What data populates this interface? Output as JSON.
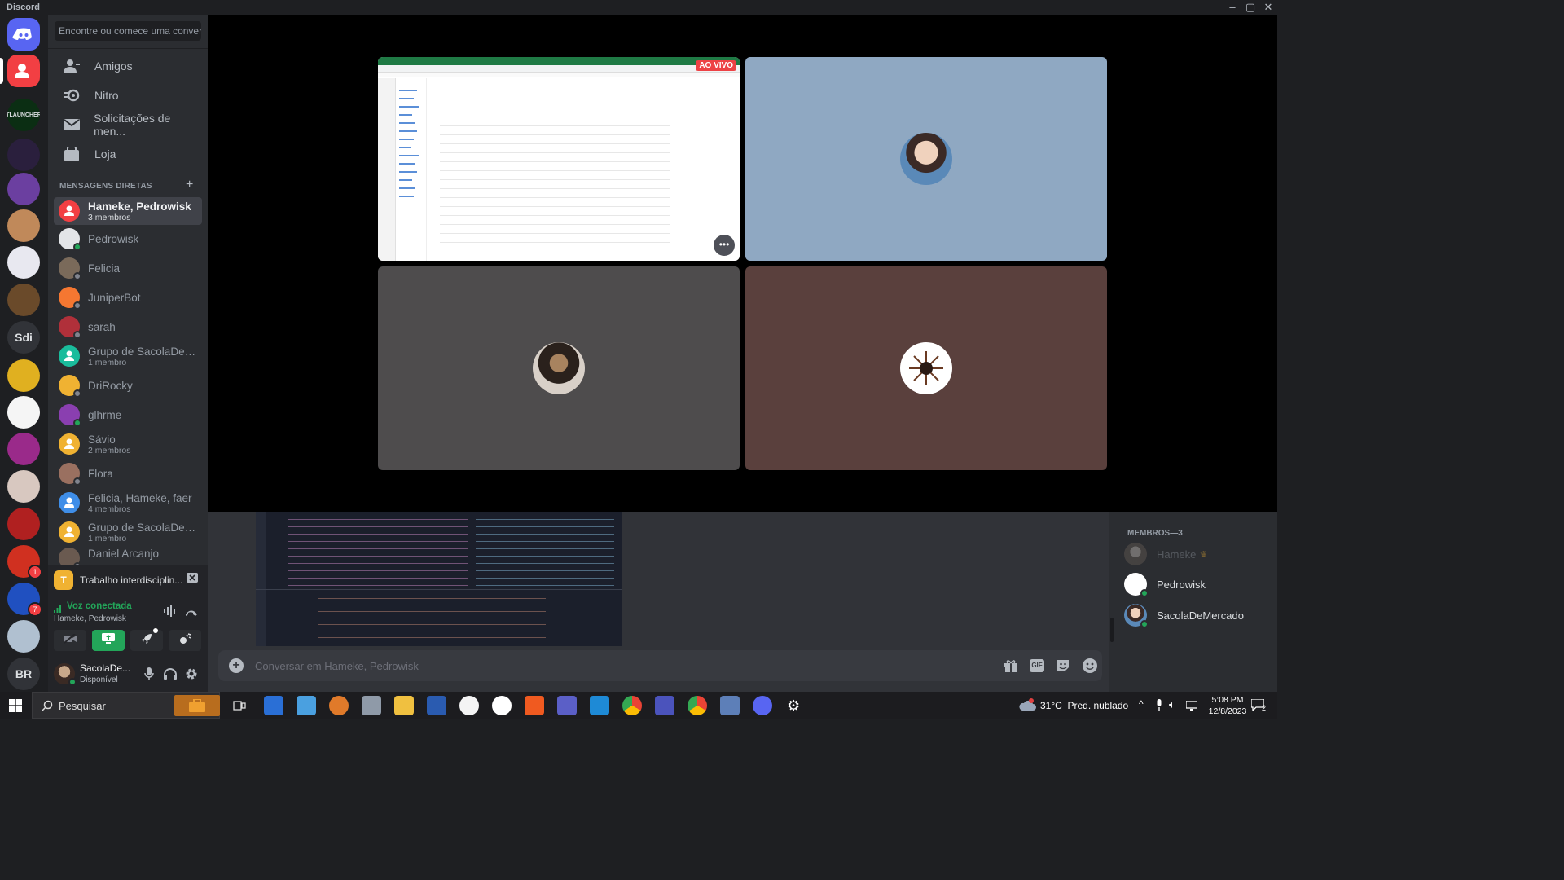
{
  "window": {
    "title": "Discord"
  },
  "sidebar": {
    "search_placeholder": "Encontre ou comece uma conver...",
    "nav": [
      {
        "label": "Amigos",
        "icon": "friends-icon"
      },
      {
        "label": "Nitro",
        "icon": "nitro-icon"
      },
      {
        "label": "Solicitações de men...",
        "icon": "message-requests-icon"
      },
      {
        "label": "Loja",
        "icon": "shop-icon"
      }
    ],
    "dm_header": "MENSAGENS DIRETAS",
    "dms": [
      {
        "name": "Hameke, Pedrowisk",
        "sub": "3 membros",
        "color": "#f23f43"
      },
      {
        "name": "Pedrowisk",
        "sub": "",
        "color": "#e3e5e8"
      },
      {
        "name": "Felicia",
        "sub": "",
        "color": "#7a6a5a"
      },
      {
        "name": "JuniperBot",
        "sub": "",
        "color": "#f57731"
      },
      {
        "name": "sarah",
        "sub": "",
        "color": "#b0303a"
      },
      {
        "name": "Grupo de SacolaDeM...",
        "sub": "1 membro",
        "color": "#1abc9c"
      },
      {
        "name": "DriRocky",
        "sub": "",
        "color": "#f0b232"
      },
      {
        "name": "glhrme",
        "sub": "",
        "color": "#8a3fb0"
      },
      {
        "name": "Sávio",
        "sub": "2 membros",
        "color": "#f0b232"
      },
      {
        "name": "Flora",
        "sub": "",
        "color": "#9a7060"
      },
      {
        "name": "Felicia, Hameke, faer",
        "sub": "4 membros",
        "color": "#3f8ee8"
      },
      {
        "name": "Grupo de SacolaDeM...",
        "sub": "1 membro",
        "color": "#f0b232"
      },
      {
        "name": "Daniel Arcanjo",
        "sub": "",
        "color": "#6a5a50"
      }
    ],
    "activity": {
      "label": "Trabalho interdisciplin...",
      "badge": "T"
    },
    "voice": {
      "status": "Voz conectada",
      "channel": "Hameke, Pedrowisk"
    },
    "user": {
      "name": "SacolaDe...",
      "status": "Disponível"
    }
  },
  "servers": [
    {
      "label": "",
      "color": "#5865f2",
      "badge": ""
    },
    {
      "label": "",
      "color": "#f23f43",
      "badge": ""
    },
    {
      "label": "TLAUNCHER",
      "color": "#0b2e13",
      "badge": ""
    },
    {
      "label": "",
      "color": "#2a1f3d",
      "badge": ""
    },
    {
      "label": "",
      "color": "#6b3fa0",
      "badge": ""
    },
    {
      "label": "",
      "color": "#c0895a",
      "badge": ""
    },
    {
      "label": "",
      "color": "#e8e8f0",
      "badge": ""
    },
    {
      "label": "",
      "color": "#6a4a2a",
      "badge": ""
    },
    {
      "label": "Sdi",
      "color": "#313338",
      "badge": ""
    },
    {
      "label": "",
      "color": "#e0b020",
      "badge": ""
    },
    {
      "label": "",
      "color": "#f5f5f5",
      "badge": ""
    },
    {
      "label": "",
      "color": "#9a2a8a",
      "badge": ""
    },
    {
      "label": "",
      "color": "#d8c8c0",
      "badge": ""
    },
    {
      "label": "",
      "color": "#b02020",
      "badge": ""
    },
    {
      "label": "",
      "color": "#d03020",
      "badge": "1"
    },
    {
      "label": "",
      "color": "#2050c0",
      "badge": "7"
    },
    {
      "label": "",
      "color": "#b0c0d0",
      "badge": ""
    },
    {
      "label": "BR",
      "color": "#313338",
      "badge": ""
    }
  ],
  "stage": {
    "live_badge": "AO VIVO",
    "tiles": [
      {
        "kind": "screen",
        "bg": "#ffffff"
      },
      {
        "kind": "avatar",
        "bg": "#8fa8c2"
      },
      {
        "kind": "avatar",
        "bg": "#4e4c4d"
      },
      {
        "kind": "avatar",
        "bg": "#5a403d"
      }
    ]
  },
  "chat": {
    "placeholder": "Conversar em Hameke, Pedrowisk"
  },
  "members": {
    "header": "MEMBROS—3",
    "list": [
      {
        "name": "Hameke",
        "owner": true
      },
      {
        "name": "Pedrowisk",
        "owner": false
      },
      {
        "name": "SacolaDeMercado",
        "owner": false
      }
    ]
  },
  "taskbar": {
    "search": "Pesquisar",
    "weather": "31°C  Pred. nublado",
    "time": "5:08 PM",
    "date": "12/8/2023",
    "notif_count": "2"
  }
}
